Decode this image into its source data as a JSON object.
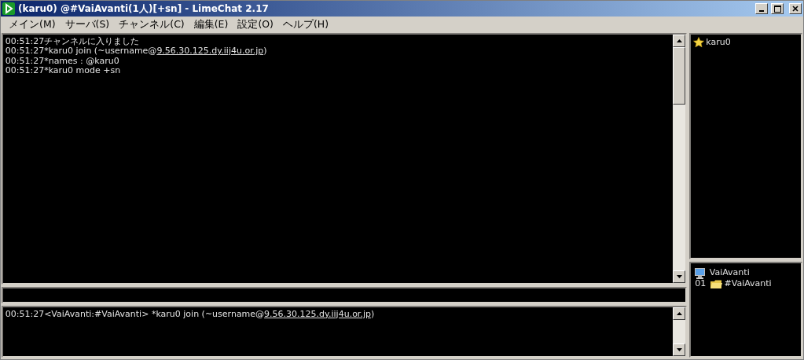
{
  "window": {
    "title": "(karu0) @#VaiAvanti(1人)[+sn]  - LimeChat 2.17"
  },
  "menu": [
    "メイン(M)",
    "サーバ(S)",
    "チャンネル(C)",
    "編集(E)",
    "設定(O)",
    "ヘルプ(H)"
  ],
  "log": [
    {
      "text": "00:51:27チャンネルに入りました"
    },
    {
      "text": "00:51:27*karu0 join (~username@",
      "link": "9.56.30.125.dy.iij4u.or.jp",
      "suffix": ")"
    },
    {
      "text": "00:51:27*names : @karu0"
    },
    {
      "text": "00:51:27*karu0 mode +sn"
    }
  ],
  "members": [
    {
      "name": "karu0"
    }
  ],
  "console_log": [
    {
      "text": "00:51:27<VaiAvanti:#VaiAvanti> *karu0 join (~username@",
      "link": "9.56.30.125.dy.iij4u.or.jp",
      "suffix": ")"
    }
  ],
  "servers": [
    {
      "name": "VaiAvanti",
      "children": [
        {
          "number": "01",
          "name": "#VaiAvanti"
        }
      ]
    }
  ]
}
